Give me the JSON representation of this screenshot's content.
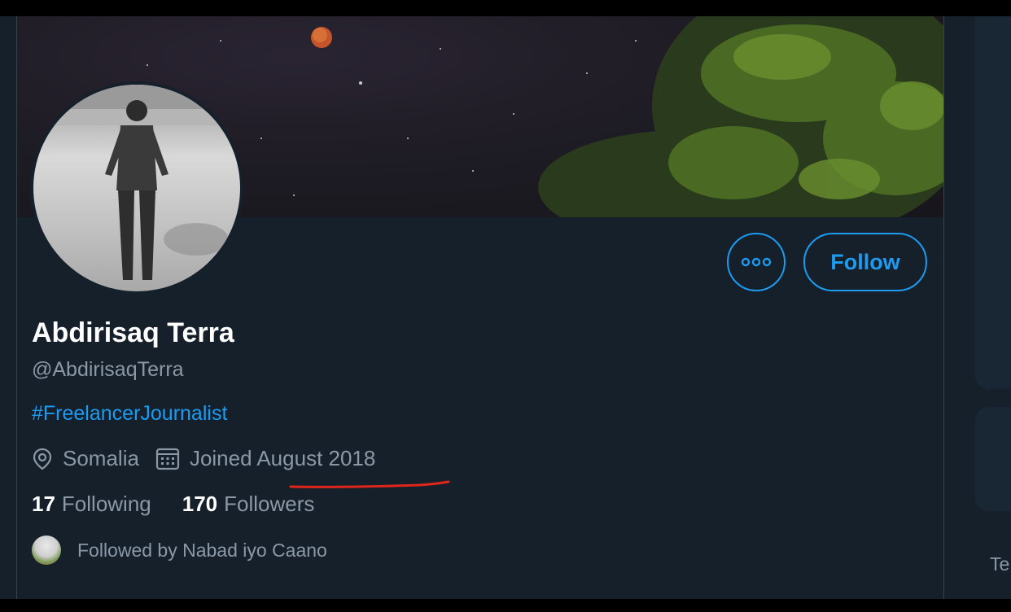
{
  "profile": {
    "name": "Abdirisaq Terra",
    "handle": "@AbdirisaqTerra",
    "bio": "#FreelancerJournalist",
    "location": "Somalia",
    "joined": "Joined August 2018",
    "following_count": "17",
    "following_label": "Following",
    "followers_count": "170",
    "followers_label": "Followers",
    "followed_by": "Followed by Nabad iyo Caano"
  },
  "actions": {
    "follow_label": "Follow"
  },
  "right_panel": {
    "partial_text": "Te"
  },
  "icons": {
    "more": "more-options-icon",
    "location": "location-pin-icon",
    "calendar": "calendar-icon"
  },
  "colors": {
    "accent": "#1d9bf0",
    "background": "#15202b",
    "annotation": "#e0251b"
  }
}
